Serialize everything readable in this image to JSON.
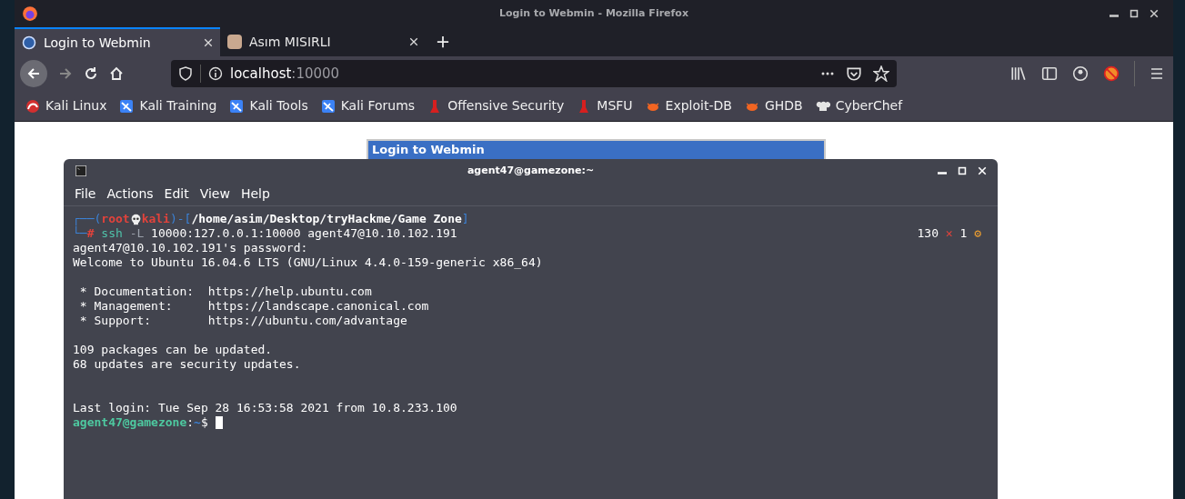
{
  "window": {
    "title": "Login to Webmin - Mozilla Firefox"
  },
  "tabs": [
    {
      "label": "Login to Webmin",
      "selected": true
    },
    {
      "label": "Asım MISIRLI",
      "selected": false
    }
  ],
  "address_bar": {
    "host": "localhost",
    "port": ":10000"
  },
  "bookmarks": [
    {
      "label": "Kali Linux",
      "kind": "kali-red"
    },
    {
      "label": "Kali Training",
      "kind": "kali-blue"
    },
    {
      "label": "Kali Tools",
      "kind": "kali-blue"
    },
    {
      "label": "Kali Forums",
      "kind": "kali-blue"
    },
    {
      "label": "Offensive Security",
      "kind": "offsec"
    },
    {
      "label": "MSFU",
      "kind": "offsec"
    },
    {
      "label": "Exploit-DB",
      "kind": "bug"
    },
    {
      "label": "GHDB",
      "kind": "bug"
    },
    {
      "label": "CyberChef",
      "kind": "chef"
    }
  ],
  "webmin_login": {
    "title": "Login to Webmin"
  },
  "terminal": {
    "title": "agent47@gamezone:~",
    "menu": [
      "File",
      "Actions",
      "Edit",
      "View",
      "Help"
    ],
    "prompt": {
      "open": "┌──(",
      "user": "root",
      "host": "kali",
      "mid": ")-[",
      "path": "/home/asim/Desktop/tryHackme/Game Zone",
      "close": "]",
      "corner": "└─",
      "symbol": "#",
      "command": "ssh",
      "option": "-L",
      "args": "10000:127.0.0.1:10000 agent47@10.10.102.191"
    },
    "status": {
      "exit_code": "130",
      "error_mark": "✕",
      "jobs": "1",
      "gear": "⚙"
    },
    "lines": [
      {
        "kind": "output",
        "text": "agent47@10.10.102.191's password:"
      },
      {
        "kind": "output",
        "text": "Welcome to Ubuntu 16.04.6 LTS (GNU/Linux 4.4.0-159-generic x86_64)"
      },
      {
        "kind": "blank"
      },
      {
        "kind": "output",
        "text": " * Documentation:  https://help.ubuntu.com"
      },
      {
        "kind": "output",
        "text": " * Management:     https://landscape.canonical.com"
      },
      {
        "kind": "output",
        "text": " * Support:        https://ubuntu.com/advantage"
      },
      {
        "kind": "blank"
      },
      {
        "kind": "output",
        "text": "109 packages can be updated."
      },
      {
        "kind": "output",
        "text": "68 updates are security updates."
      },
      {
        "kind": "blank"
      },
      {
        "kind": "blank"
      },
      {
        "kind": "output",
        "text": "Last login: Tue Sep 28 16:53:58 2021 from 10.8.233.100"
      }
    ],
    "final_prompt": {
      "user_host": "agent47@gamezone",
      "colon": ":",
      "path": "~",
      "symbol": "$"
    }
  }
}
